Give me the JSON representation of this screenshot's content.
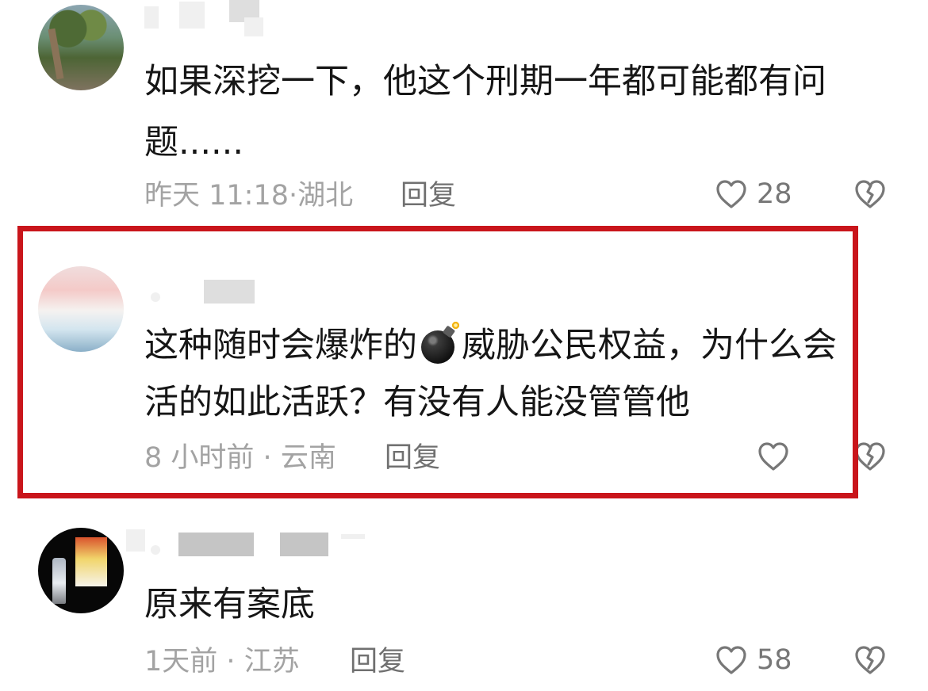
{
  "comments": [
    {
      "text_lines": [
        "如果深挖一下，他这个刑期一年都可能都有问",
        "题......"
      ],
      "time": "昨天 11:18",
      "location": "湖北",
      "meta_separator": "·",
      "reply_label": "回复",
      "like_count": "28",
      "avatar_icon": "profile-photo-icon",
      "like_icon": "heart-icon",
      "dislike_icon": "broken-heart-icon"
    },
    {
      "text_part_1": "这种随时会爆炸的",
      "emoji_icon": "bomb-emoji-icon",
      "text_part_2": "威胁公民权益，为什么会",
      "text_line_2": "活的如此活跃？有没有人能没管管他",
      "time": "8 小时前",
      "location": "云南",
      "meta_separator": "·",
      "reply_label": "回复",
      "like_count": "",
      "avatar_icon": "profile-photo-icon",
      "like_icon": "heart-icon",
      "dislike_icon": "broken-heart-icon",
      "highlight_color": "#c9151b"
    },
    {
      "text_lines": [
        "原来有案底"
      ],
      "time": "1天前",
      "location": "江苏",
      "meta_separator": "·",
      "reply_label": "回复",
      "like_count": "58",
      "avatar_icon": "profile-photo-icon",
      "like_icon": "heart-icon",
      "dislike_icon": "broken-heart-icon"
    }
  ],
  "colors": {
    "primary_text": "#161616",
    "meta_text": "#a3a3a3",
    "reply_text": "#707070",
    "icon_stroke": "#777777",
    "highlight_border": "#c9151b"
  }
}
